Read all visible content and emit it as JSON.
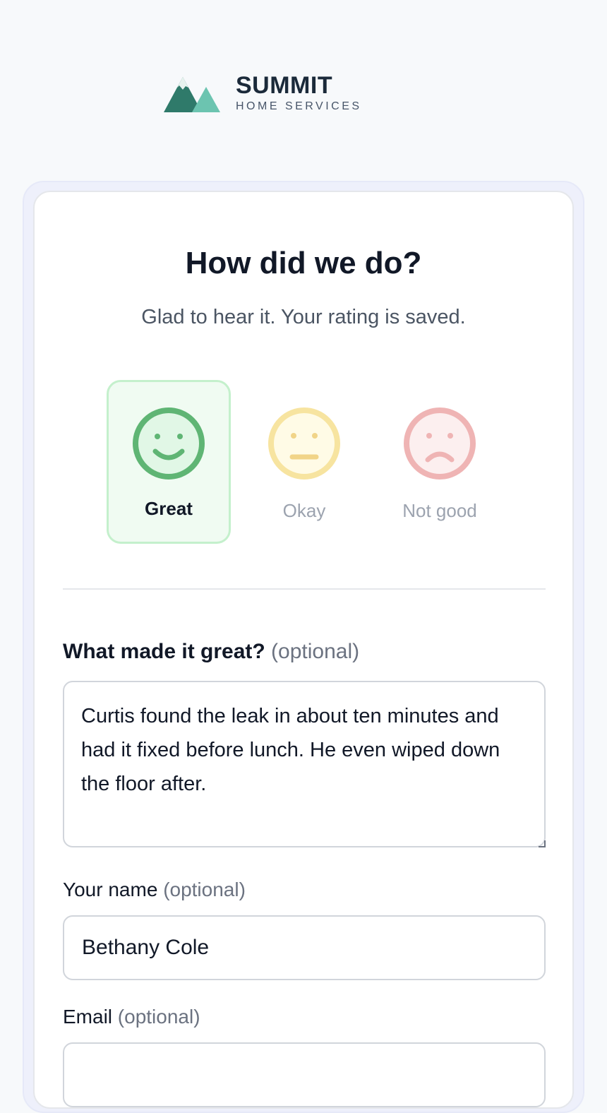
{
  "brand": {
    "name": "SUMMIT",
    "tagline": "HOME SERVICES",
    "colors": {
      "mountain_dark": "#2f7a6a",
      "mountain_light": "#6cc4b0",
      "peak_snow": "#e8f3ef"
    }
  },
  "header": {
    "title": "How did we do?",
    "subtitle": "Glad to hear it. Your rating is saved."
  },
  "ratings": [
    {
      "label": "Great",
      "selected": true,
      "icon": "smiley-happy-icon",
      "color": "#5fb574"
    },
    {
      "label": "Okay",
      "selected": false,
      "icon": "smiley-neutral-icon",
      "color": "#f7e4a0"
    },
    {
      "label": "Not good",
      "selected": false,
      "icon": "smiley-sad-icon",
      "color": "#efb4b4"
    }
  ],
  "form": {
    "feedback": {
      "label": "What made it great?",
      "optional": "(optional)",
      "value": "Curtis found the leak in about ten minutes and had it fixed before lunch. He even wiped down the floor after."
    },
    "name": {
      "label": "Your name",
      "optional": "(optional)",
      "value": "Bethany Cole"
    },
    "email": {
      "label": "Email",
      "optional": "(optional)",
      "value": ""
    }
  }
}
